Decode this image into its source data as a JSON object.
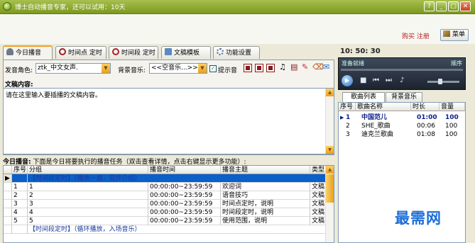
{
  "window": {
    "title": "博士自动播音专家，还可以试用：10天"
  },
  "titlebar_buttons": {
    "help": "?",
    "minimize": "_",
    "maximize": "□",
    "close": "✕"
  },
  "header": {
    "buy_register": "购买 注册",
    "menu_label": "菜单"
  },
  "tabs": [
    {
      "label": "今日播音"
    },
    {
      "label": "时间点 定时"
    },
    {
      "label": "时间段 定时"
    },
    {
      "label": "文稿模板"
    },
    {
      "label": "功能设置"
    }
  ],
  "clock": "10: 50: 30",
  "form": {
    "voice_label": "发音角色:",
    "voice_value": "ztk_中文女声.",
    "bgm_label": "背景音乐:",
    "bgm_value": "<<空音乐...>>",
    "prompt_tone_label": "提示音",
    "prompt_tone_checked": "✓",
    "content_label": "文稿内容:",
    "content_text": "请在这里输入要插播的文稿内容。"
  },
  "today": {
    "title": "今日播音:",
    "hint": "下面是今日将要执行的播音任务（双击查看详情，点击右键显示更多功能）:",
    "columns": [
      "序号",
      "分组",
      "播音时间",
      "播音主题",
      "类型"
    ],
    "rows": [
      {
        "seq": "",
        "group": "【时间段定时】（播放一遍，软件介绍）",
        "time": "",
        "topic": "",
        "type": "",
        "kind": "grp-sel"
      },
      {
        "seq": "1",
        "group": "1",
        "time": "00:00:00~23:59:59",
        "topic": "欢迎词",
        "type": "文稿",
        "kind": ""
      },
      {
        "seq": "2",
        "group": "2",
        "time": "00:00:00~23:59:59",
        "topic": "语音技巧",
        "type": "文稿",
        "kind": ""
      },
      {
        "seq": "3",
        "group": "3",
        "time": "00:00:00~23:59:59",
        "topic": "时间点定时，说明",
        "type": "文稿",
        "kind": ""
      },
      {
        "seq": "4",
        "group": "4",
        "time": "00:00:00~23:59:59",
        "topic": "时间段定时，说明",
        "type": "文稿",
        "kind": ""
      },
      {
        "seq": "5",
        "group": "5",
        "time": "00:00:00~23:59:59",
        "topic": "使用范围，说明",
        "type": "文稿",
        "kind": ""
      },
      {
        "seq": "",
        "group": "【时间段定时】（循环播放，入场音乐）",
        "time": "",
        "topic": "",
        "type": "",
        "kind": "grp"
      }
    ]
  },
  "player": {
    "status": "准备就绪",
    "order": "顺序"
  },
  "playlist": {
    "tabs": [
      "歌曲列表",
      "背景音乐"
    ],
    "columns": [
      "序号",
      "歌曲名称",
      "时长",
      "音量"
    ],
    "rows": [
      {
        "seq": "1",
        "name": "中国范儿",
        "duration": "01:00",
        "volume": "100",
        "current": true
      },
      {
        "seq": "2",
        "name": "SHE_歌曲",
        "duration": "00:06",
        "volume": "100",
        "current": false
      },
      {
        "seq": "3",
        "name": "迪克兰歌曲",
        "duration": "01:08",
        "volume": "100",
        "current": false
      }
    ]
  },
  "watermark": "最需网",
  "colors": {
    "title_bar": "#7c9a1e",
    "selection": "#0a5fc8",
    "accent": "#e8a020",
    "watermark": "#1e6fd8"
  }
}
